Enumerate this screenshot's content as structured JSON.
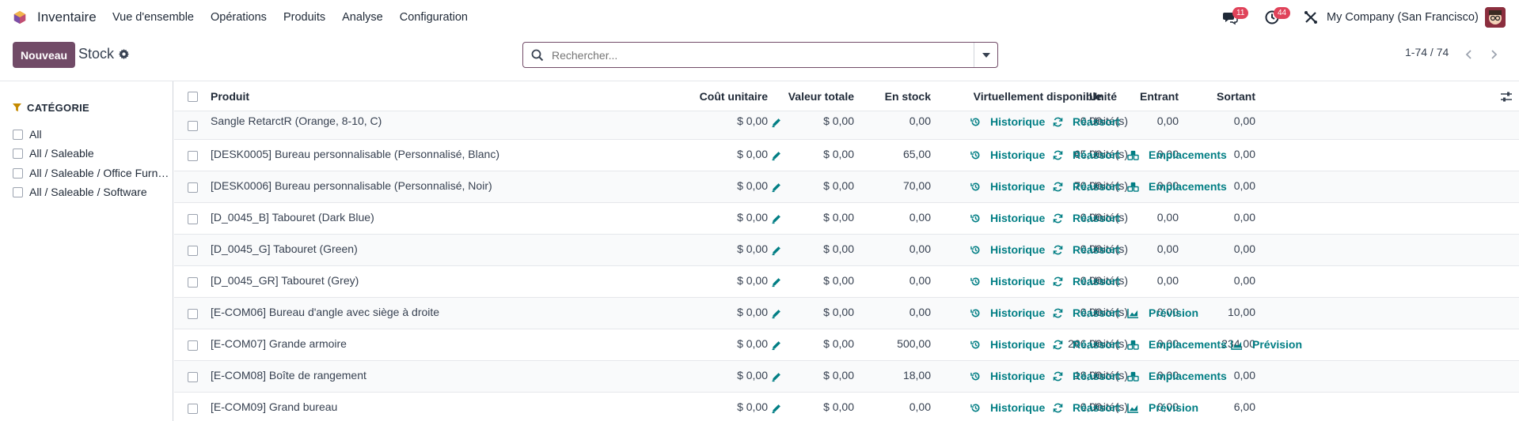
{
  "app": {
    "name": "Inventaire"
  },
  "menu": [
    "Vue d'ensemble",
    "Opérations",
    "Produits",
    "Analyse",
    "Configuration"
  ],
  "navbar": {
    "messages_badge": "11",
    "activities_badge": "44",
    "company": "My Company (San Francisco)"
  },
  "control": {
    "new_label": "Nouveau",
    "breadcrumb": "Stock",
    "search_placeholder": "Rechercher...",
    "pager": "1-74 / 74"
  },
  "sidebar": {
    "title": "CATÉGORIE",
    "items": [
      "All",
      "All / Saleable",
      "All / Saleable / Office Furniture",
      "All / Saleable / Software"
    ]
  },
  "table": {
    "headers": {
      "product": "Produit",
      "unit_cost": "Coût unitaire",
      "total_value": "Valeur totale",
      "on_hand": "En stock",
      "forecasted": "Virtuellement disponible",
      "incoming": "Entrant",
      "outgoing": "Sortant",
      "uom": "Unité"
    },
    "action_labels": {
      "history": "Historique",
      "replenish": "Réassort",
      "locations": "Emplacements",
      "forecast": "Prévision"
    },
    "rows": [
      {
        "product": "Sangle RetarctR (Orange, 8-10, C)",
        "unit_cost": "$ 0,00",
        "total_value": "$ 0,00",
        "on_hand": "0,00",
        "forecasted": "0,00",
        "incoming": "0,00",
        "outgoing": "0,00",
        "uom": "Unité(s)",
        "actions": [
          "history",
          "replenish"
        ]
      },
      {
        "product": "[DESK0005] Bureau personnalisable (Personnalisé, Blanc)",
        "unit_cost": "$ 0,00",
        "total_value": "$ 0,00",
        "on_hand": "65,00",
        "forecasted": "65,00",
        "incoming": "0,00",
        "outgoing": "0,00",
        "uom": "Unité(s)",
        "actions": [
          "history",
          "replenish",
          "locations"
        ]
      },
      {
        "product": "[DESK0006] Bureau personnalisable (Personnalisé, Noir)",
        "unit_cost": "$ 0,00",
        "total_value": "$ 0,00",
        "on_hand": "70,00",
        "forecasted": "70,00",
        "incoming": "0,00",
        "outgoing": "0,00",
        "uom": "Unité(s)",
        "actions": [
          "history",
          "replenish",
          "locations"
        ]
      },
      {
        "product": "[D_0045_B] Tabouret (Dark Blue)",
        "unit_cost": "$ 0,00",
        "total_value": "$ 0,00",
        "on_hand": "0,00",
        "forecasted": "0,00",
        "incoming": "0,00",
        "outgoing": "0,00",
        "uom": "Unité(s)",
        "actions": [
          "history",
          "replenish"
        ]
      },
      {
        "product": "[D_0045_G] Tabouret (Green)",
        "unit_cost": "$ 0,00",
        "total_value": "$ 0,00",
        "on_hand": "0,00",
        "forecasted": "0,00",
        "incoming": "0,00",
        "outgoing": "0,00",
        "uom": "Unité(s)",
        "actions": [
          "history",
          "replenish"
        ]
      },
      {
        "product": "[D_0045_GR] Tabouret (Grey)",
        "unit_cost": "$ 0,00",
        "total_value": "$ 0,00",
        "on_hand": "0,00",
        "forecasted": "0,00",
        "incoming": "0,00",
        "outgoing": "0,00",
        "uom": "Unité(s)",
        "actions": [
          "history",
          "replenish"
        ]
      },
      {
        "product": "[E-COM06] Bureau d'angle avec siège à droite",
        "unit_cost": "$ 0,00",
        "total_value": "$ 0,00",
        "on_hand": "0,00",
        "forecasted": "0,00",
        "incoming": "0,00",
        "outgoing": "10,00",
        "uom": "Unité(s)",
        "actions": [
          "history",
          "replenish",
          "forecast"
        ]
      },
      {
        "product": "[E-COM07] Grande armoire",
        "unit_cost": "$ 0,00",
        "total_value": "$ 0,00",
        "on_hand": "500,00",
        "forecasted": "266,00",
        "incoming": "0,00",
        "outgoing": "234,00",
        "uom": "Unité(s)",
        "actions": [
          "history",
          "replenish",
          "locations",
          "forecast"
        ]
      },
      {
        "product": "[E-COM08] Boîte de rangement",
        "unit_cost": "$ 0,00",
        "total_value": "$ 0,00",
        "on_hand": "18,00",
        "forecasted": "18,00",
        "incoming": "0,00",
        "outgoing": "0,00",
        "uom": "Unité(s)",
        "actions": [
          "history",
          "replenish",
          "locations"
        ]
      },
      {
        "product": "[E-COM09] Grand bureau",
        "unit_cost": "$ 0,00",
        "total_value": "$ 0,00",
        "on_hand": "0,00",
        "forecasted": "0,00",
        "incoming": "0,00",
        "outgoing": "6,00",
        "uom": "Unité(s)",
        "actions": [
          "history",
          "replenish",
          "forecast"
        ]
      }
    ]
  },
  "colors": {
    "brand": "#714b67",
    "action": "#017e84",
    "badge": "#e0435a"
  }
}
